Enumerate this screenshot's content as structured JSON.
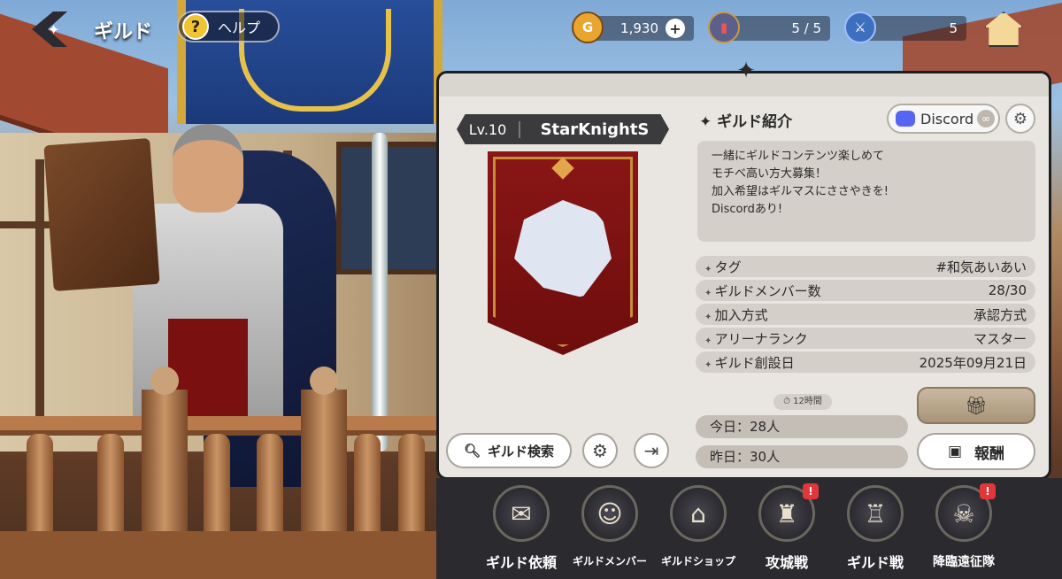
{
  "header": {
    "title": "ギルド",
    "help_label": "ヘルプ",
    "help_icon": "?"
  },
  "resources": {
    "gold": {
      "icon": "G",
      "value": "1,930"
    },
    "stamina": {
      "value": "5 / 5"
    },
    "tickets": {
      "value": "5"
    }
  },
  "guild": {
    "level": "Lv.10",
    "name": "StarKnightS",
    "intro_title": "ギルド紹介",
    "discord_label": "Discord",
    "description": [
      "一緒にギルドコンテンツ楽しめて",
      "モチベ高い方大募集！",
      "加入希望はギルマスにささやきを!",
      "Discordあり!"
    ],
    "info": [
      {
        "key": "タグ",
        "value": "#和気あいあい"
      },
      {
        "key": "ギルドメンバー数",
        "value": "28/30"
      },
      {
        "key": "加入方式",
        "value": "承認方式"
      },
      {
        "key": "アリーナランク",
        "value": "マスター"
      },
      {
        "key": "ギルド創設日",
        "value": "2025年09月21日"
      }
    ],
    "timer": "12時間",
    "today": "今日：28人",
    "yesterday": "昨日：30人",
    "reward_label": "報酬",
    "search_label": "ギルド検索"
  },
  "dock": [
    {
      "label": "ギルド依頼",
      "alert": false
    },
    {
      "label": "ギルドメンバー",
      "alert": false
    },
    {
      "label": "ギルドショップ",
      "alert": false
    },
    {
      "label": "攻城戦",
      "alert": true
    },
    {
      "label": "ギルド戦",
      "alert": false
    },
    {
      "label": "降臨遠征隊",
      "alert": true
    }
  ],
  "alert_mark": "!",
  "colors": {
    "panel": "#e9e6e1",
    "banner_red": "#8a1616",
    "alert": "#e2363a",
    "dock": "#2b2a2e"
  }
}
